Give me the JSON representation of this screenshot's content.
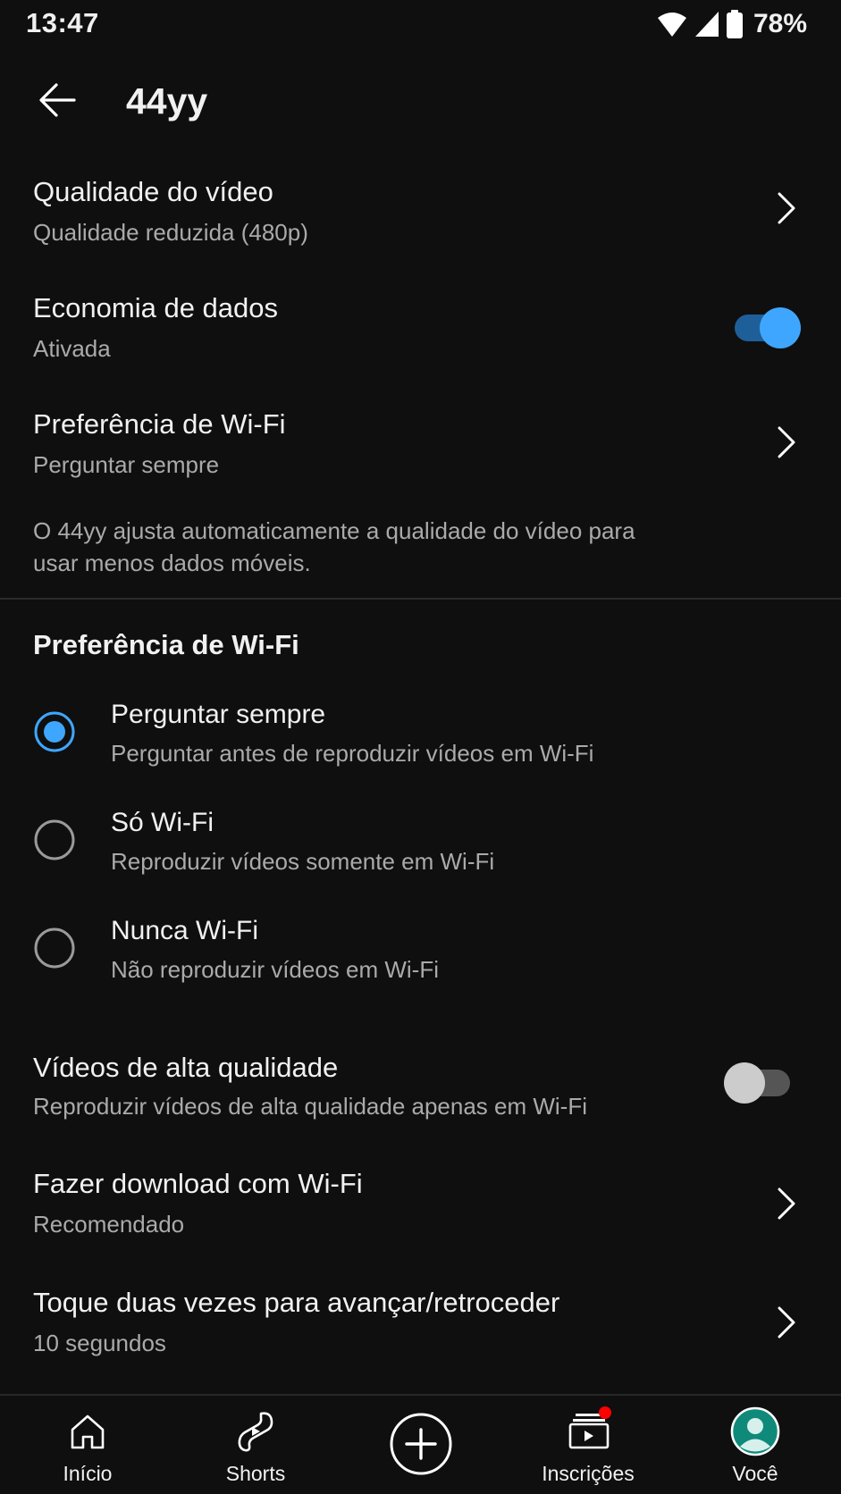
{
  "status_bar": {
    "time": "13:47",
    "battery": "78%",
    "icons": [
      "wifi-icon",
      "cell-signal-icon",
      "battery-icon"
    ]
  },
  "header": {
    "back_icon": "arrow-left-icon",
    "title": "44yy"
  },
  "settings": {
    "video_quality": {
      "title": "Qualidade do vídeo",
      "value": "Qualidade reduzida (480p)"
    },
    "data_saver": {
      "title": "Economia de dados",
      "value": "Ativada",
      "enabled": true
    },
    "wifi_preference": {
      "title": "Preferência de Wi-Fi",
      "value": "Perguntar sempre"
    },
    "note": "O 44yy ajusta automaticamente a qualidade do vídeo para usar menos dados móveis."
  },
  "wifi_section": {
    "title": "Preferência de Wi-Fi",
    "options": [
      {
        "title": "Perguntar sempre",
        "subtitle": "Perguntar antes de reproduzir vídeos em Wi-Fi",
        "selected": true
      },
      {
        "title": "Só Wi-Fi",
        "subtitle": "Reproduzir vídeos somente em Wi-Fi",
        "selected": false
      },
      {
        "title": "Nunca Wi-Fi",
        "subtitle": "Não reproduzir vídeos em Wi-Fi",
        "selected": false
      }
    ]
  },
  "more_settings": {
    "hq_videos": {
      "title": "Vídeos de alta qualidade",
      "value": "Reproduzir vídeos de alta qualidade apenas em Wi-Fi",
      "enabled": false
    },
    "download_wifi": {
      "title": "Fazer download com Wi-Fi",
      "value": "Recomendado"
    },
    "double_tap": {
      "title": "Toque duas vezes para avançar/retroceder",
      "value": "10 segundos"
    }
  },
  "bottom_nav": [
    {
      "label": "Início",
      "icon": "home-icon"
    },
    {
      "label": "Shorts",
      "icon": "shorts-icon"
    },
    {
      "label": "",
      "icon": "create-plus-icon"
    },
    {
      "label": "Inscrições",
      "icon": "subscriptions-icon",
      "badge": true
    },
    {
      "label": "Você",
      "icon": "avatar-icon"
    }
  ],
  "colors": {
    "background": "#0f0f0f",
    "accent": "#3ea6ff",
    "secondary_text": "#aaaaaa",
    "badge": "#ff0000"
  }
}
